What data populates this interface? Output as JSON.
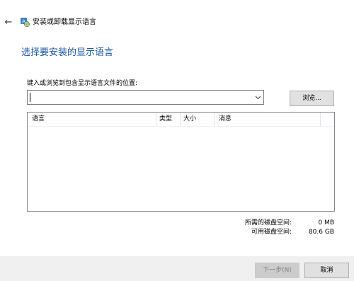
{
  "window": {
    "title": "安装或卸载显示语言"
  },
  "page": {
    "heading": "选择要安装的显示语言"
  },
  "path": {
    "label": "键入或浏览到包含显示语言文件的位置:",
    "value": "",
    "placeholder": "",
    "browse_label": "浏览..."
  },
  "list": {
    "columns": {
      "language": "语言",
      "type": "类型",
      "size": "大小",
      "message": "消息"
    },
    "rows": []
  },
  "disk": {
    "required_label": "所需的磁盘空间:",
    "required_value": "0 MB",
    "available_label": "可用磁盘空间:",
    "available_value": "80.6 GB"
  },
  "footer": {
    "next_label": "下一步(N)",
    "cancel_label": "取消"
  },
  "icons": {
    "back": "back-arrow-icon",
    "app": "language-globe-icon",
    "dropdown": "chevron-down-icon"
  },
  "colors": {
    "heading": "#1a57a6",
    "footer_bg": "#f0f0f0",
    "button_bg": "#e1e1e1",
    "disabled_button_bg": "#cccccc"
  }
}
